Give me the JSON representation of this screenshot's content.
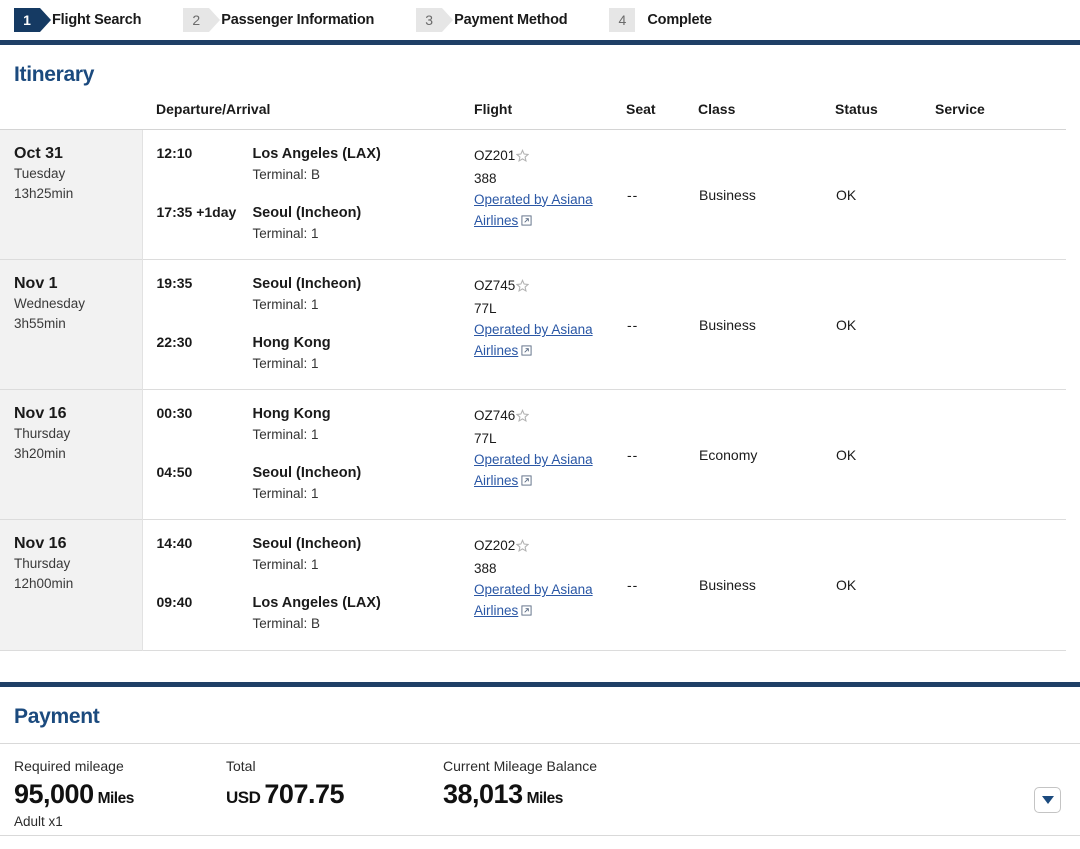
{
  "steps": [
    {
      "num": "1",
      "label": "Flight Search",
      "state": "active",
      "shape": "chevron"
    },
    {
      "num": "2",
      "label": "Passenger Information",
      "state": "idle",
      "shape": "chevron"
    },
    {
      "num": "3",
      "label": "Payment Method",
      "state": "idle",
      "shape": "chevron"
    },
    {
      "num": "4",
      "label": "Complete",
      "state": "idle",
      "shape": "square"
    }
  ],
  "itinerary": {
    "title": "Itinerary",
    "columns": {
      "date": "",
      "departure_arrival": "Departure/Arrival",
      "flight": "Flight",
      "seat": "Seat",
      "class": "Class",
      "status": "Status",
      "service": "Service"
    },
    "rows": [
      {
        "date": "Oct 31",
        "weekday": "Tuesday",
        "duration": "13h25min",
        "depart_time": "12:10",
        "depart_place": "Los Angeles (LAX)",
        "depart_terminal": "Terminal: B",
        "arrive_time": "17:35",
        "arrive_plusday": "+1day",
        "arrive_place": "Seoul (Incheon)",
        "arrive_terminal": "Terminal: 1",
        "flight_no": "OZ201",
        "aircraft": "388",
        "operated_by": "Operated by Asiana Airlines",
        "seat": "--",
        "class": "Business",
        "status": "OK",
        "service": ""
      },
      {
        "date": "Nov 1",
        "weekday": "Wednesday",
        "duration": "3h55min",
        "depart_time": "19:35",
        "depart_place": "Seoul (Incheon)",
        "depart_terminal": "Terminal: 1",
        "arrive_time": "22:30",
        "arrive_plusday": "",
        "arrive_place": "Hong Kong",
        "arrive_terminal": "Terminal: 1",
        "flight_no": "OZ745",
        "aircraft": "77L",
        "operated_by": "Operated by Asiana Airlines",
        "seat": "--",
        "class": "Business",
        "status": "OK",
        "service": ""
      },
      {
        "date": "Nov 16",
        "weekday": "Thursday",
        "duration": "3h20min",
        "depart_time": "00:30",
        "depart_place": "Hong Kong",
        "depart_terminal": "Terminal: 1",
        "arrive_time": "04:50",
        "arrive_plusday": "",
        "arrive_place": "Seoul (Incheon)",
        "arrive_terminal": "Terminal: 1",
        "flight_no": "OZ746",
        "aircraft": "77L",
        "operated_by": "Operated by Asiana Airlines",
        "seat": "--",
        "class": "Economy",
        "status": "OK",
        "service": ""
      },
      {
        "date": "Nov 16",
        "weekday": "Thursday",
        "duration": "12h00min",
        "depart_time": "14:40",
        "depart_place": "Seoul (Incheon)",
        "depart_terminal": "Terminal: 1",
        "arrive_time": "09:40",
        "arrive_plusday": "",
        "arrive_place": "Los Angeles (LAX)",
        "arrive_terminal": "Terminal: B",
        "flight_no": "OZ202",
        "aircraft": "388",
        "operated_by": "Operated by Asiana Airlines",
        "seat": "--",
        "class": "Business",
        "status": "OK",
        "service": ""
      }
    ]
  },
  "payment": {
    "title": "Payment",
    "required_mileage_label": "Required mileage",
    "required_mileage_value": "95,000",
    "required_mileage_unit": "Miles",
    "passenger_note": "Adult x1",
    "total_label": "Total",
    "total_currency": "USD",
    "total_value": "707.75",
    "balance_label": "Current Mileage Balance",
    "balance_value": "38,013",
    "balance_unit": "Miles"
  },
  "colors": {
    "brand_navy": "#1b4a7e",
    "bar_navy": "#1f3f66",
    "active_step": "#153a63",
    "link_blue": "#2a57a5",
    "date_bg": "#f2f2f2"
  }
}
